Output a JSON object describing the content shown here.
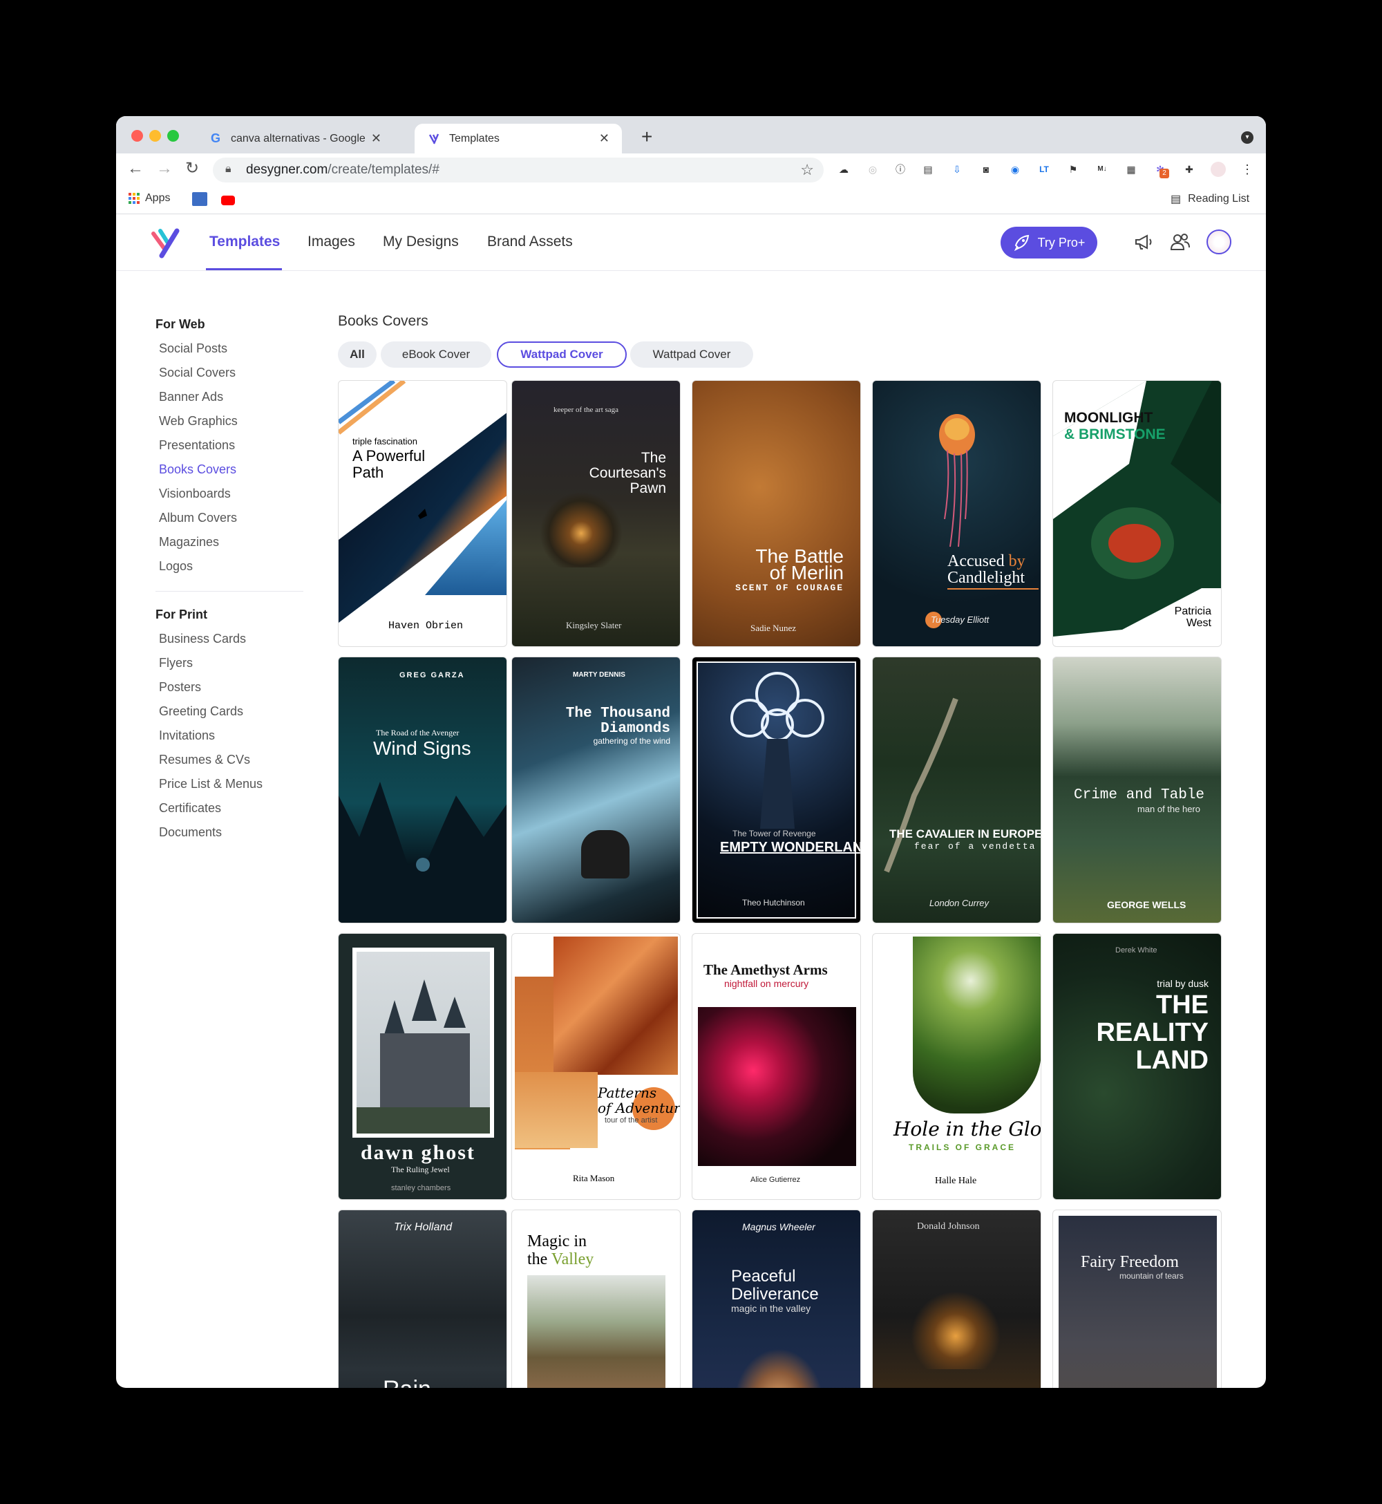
{
  "browser": {
    "tabs": [
      {
        "title": "canva alternativas - Google Se",
        "icon": "google-g-icon"
      },
      {
        "title": "Templates",
        "icon": "desygner-icon"
      }
    ],
    "url_host": "desygner.com",
    "url_path": "/create/templates/#",
    "bookmarks": [
      {
        "label": "Apps"
      }
    ],
    "reading_list": "Reading List",
    "extension_badge": "2"
  },
  "header": {
    "nav": [
      {
        "label": "Templates",
        "active": true
      },
      {
        "label": "Images"
      },
      {
        "label": "My Designs"
      },
      {
        "label": "Brand Assets"
      }
    ],
    "pro_label": "Try Pro+"
  },
  "sidebar": {
    "sections": [
      {
        "title": "For Web",
        "items": [
          "Social Posts",
          "Social Covers",
          "Banner Ads",
          "Web Graphics",
          "Presentations",
          "Books Covers",
          "Visionboards",
          "Album Covers",
          "Magazines",
          "Logos"
        ]
      },
      {
        "title": "For Print",
        "items": [
          "Business Cards",
          "Flyers",
          "Posters",
          "Greeting Cards",
          "Invitations",
          "Resumes & CVs",
          "Price List & Menus",
          "Certificates",
          "Documents"
        ]
      }
    ],
    "active_item": "Books Covers"
  },
  "main": {
    "title": "Books Covers",
    "filters": [
      {
        "label": "All"
      },
      {
        "label": "eBook Cover"
      },
      {
        "label": "Wattpad Cover",
        "selected": true
      },
      {
        "label": "Wattpad Cover"
      }
    ],
    "cards": [
      {
        "lines": [
          "triple fascination",
          "A Powerful",
          "Path",
          "Haven Obrien"
        ]
      },
      {
        "lines": [
          "keeper of the art saga",
          "The",
          "Courtesan's",
          "Pawn",
          "Kingsley Slater"
        ]
      },
      {
        "lines": [
          "The Battle",
          "of Merlin",
          "SCENT OF COURAGE",
          "Sadie Nunez"
        ]
      },
      {
        "lines": [
          "Accused",
          "by",
          "Candlelight",
          "Tuesday Elliott"
        ]
      },
      {
        "lines": [
          "MOONLIGHT",
          "& BRIMSTONE",
          "Patricia",
          "West"
        ]
      },
      {
        "lines": [
          "GREG GARZA",
          "The Road of the Avenger",
          "Wind Signs"
        ]
      },
      {
        "lines": [
          "MARTY DENNIS",
          "The Thousand",
          "Diamonds",
          "gathering of the wind"
        ]
      },
      {
        "lines": [
          "The Tower of Revenge",
          "EMPTY WONDERLAND",
          "Theo Hutchinson"
        ]
      },
      {
        "lines": [
          "THE CAVALIER IN EUROPE",
          "fear of a vendetta",
          "London Currey"
        ]
      },
      {
        "lines": [
          "Crime and Table",
          "man of the hero",
          "GEORGE WELLS"
        ]
      },
      {
        "lines": [
          "dawn ghost",
          "The Ruling Jewel",
          "stanley chambers"
        ]
      },
      {
        "lines": [
          "Patterns",
          "of Adventure",
          "tour of the artist",
          "Rita Mason"
        ]
      },
      {
        "lines": [
          "The Amethyst Arms",
          "nightfall on mercury",
          "Alice Gutierrez"
        ]
      },
      {
        "lines": [
          "Hole in the Gloom",
          "TRAILS OF GRACE",
          "Halle Hale"
        ]
      },
      {
        "lines": [
          "Derek White",
          "trial by dusk",
          "THE",
          "REALITY",
          "LAND"
        ]
      },
      {
        "lines": [
          "Trix Holland",
          "Rain"
        ]
      },
      {
        "lines": [
          "Magic in",
          "the",
          "Valley"
        ]
      },
      {
        "lines": [
          "Magnus Wheeler",
          "Peaceful",
          "Deliverance",
          "magic in the valley"
        ]
      },
      {
        "lines": [
          "Donald Johnson"
        ]
      },
      {
        "lines": [
          "Fairy Freedom",
          "mountain of tears"
        ]
      }
    ]
  },
  "colors": {
    "accent": "#5b4de0",
    "chip_bg": "#eceef2"
  }
}
